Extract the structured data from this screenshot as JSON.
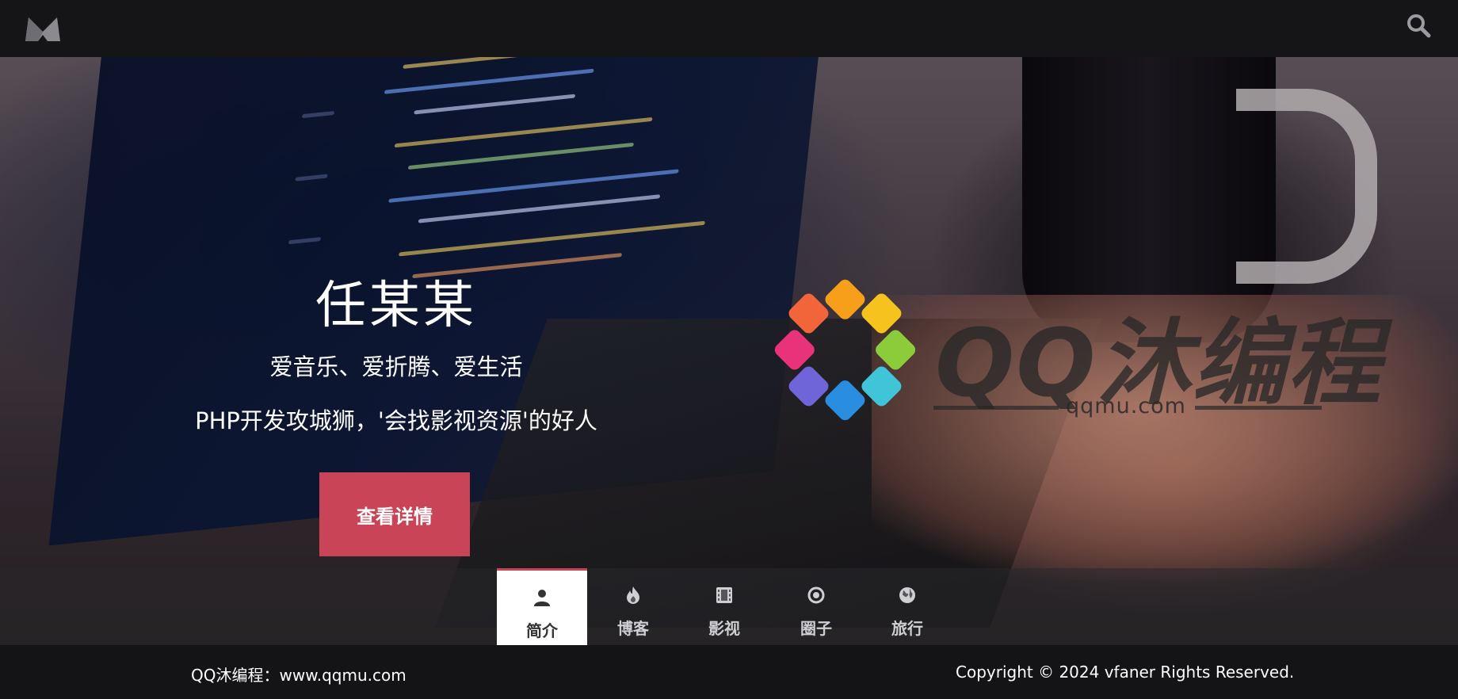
{
  "header": {
    "logo_icon": "crown-m-logo-icon",
    "search_icon": "search-icon"
  },
  "hero": {
    "name": "任某某",
    "tagline1": "爱音乐、爱折腾、爱生活",
    "tagline2": "PHP开发攻城狮，'会找影视资源'的好人",
    "cta_label": "查看详情"
  },
  "watermark": {
    "brand": "QQ沐编程",
    "url": "qqmu.com"
  },
  "tabs": [
    {
      "label": "简介",
      "icon": "user-icon",
      "active": true
    },
    {
      "label": "博客",
      "icon": "fire-icon",
      "active": false
    },
    {
      "label": "影视",
      "icon": "film-icon",
      "active": false
    },
    {
      "label": "圈子",
      "icon": "circle-dot-icon",
      "active": false
    },
    {
      "label": "旅行",
      "icon": "globe-icon",
      "active": false
    }
  ],
  "footer": {
    "left": "QQ沐编程：www.qqmu.com",
    "right": "Copyright © 2024 vfaner Rights Reserved."
  },
  "colors": {
    "accent": "#c84456",
    "topbar": "#151417",
    "footer": "#141417"
  }
}
